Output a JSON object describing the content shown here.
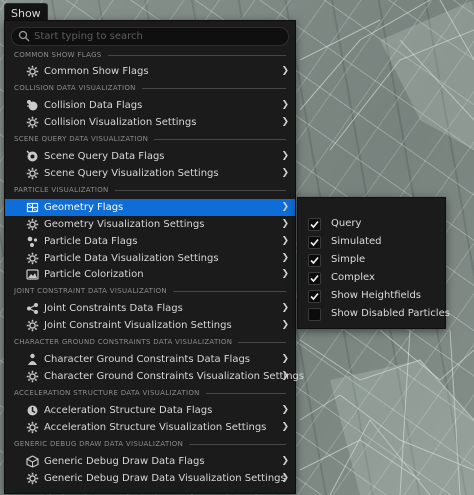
{
  "show_button": {
    "label": "Show"
  },
  "search": {
    "placeholder": "Start typing to search",
    "value": ""
  },
  "sections": [
    {
      "header": "COMMON SHOW FLAGS",
      "items": [
        {
          "label": "Common Show Flags",
          "icon": "gear-icon"
        }
      ]
    },
    {
      "header": "COLLISION DATA VISUALIZATION",
      "items": [
        {
          "label": "Collision Data Flags",
          "icon": "collision-icon"
        },
        {
          "label": "Collision Visualization Settings",
          "icon": "gear-icon"
        }
      ]
    },
    {
      "header": "SCENE QUERY DATA VISUALIZATION",
      "items": [
        {
          "label": "Scene Query Data Flags",
          "icon": "scene-query-icon"
        },
        {
          "label": "Scene Query Visualization Settings",
          "icon": "gear-icon"
        }
      ]
    },
    {
      "header": "PARTICLE VISUALIZATION",
      "items": [
        {
          "label": "Geometry Flags",
          "icon": "geometry-icon",
          "active": true
        },
        {
          "label": "Geometry Visualization Settings",
          "icon": "gear-icon"
        },
        {
          "label": "Particle Data Flags",
          "icon": "particle-icon"
        },
        {
          "label": "Particle Data Visualization Settings",
          "icon": "gear-icon"
        },
        {
          "label": "Particle Colorization",
          "icon": "colorization-icon"
        }
      ]
    },
    {
      "header": "JOINT CONSTRAINT DATA VISUALIZATION",
      "items": [
        {
          "label": "Joint Constraints Data Flags",
          "icon": "joint-icon"
        },
        {
          "label": "Joint Constraint Visualization Settings",
          "icon": "gear-icon"
        }
      ]
    },
    {
      "header": "CHARACTER GROUND CONSTRAINTS DATA VISUALIZATION",
      "items": [
        {
          "label": "Character Ground Constraints Data Flags",
          "icon": "character-icon"
        },
        {
          "label": "Character Ground Constraints Visualization Settings",
          "icon": "gear-icon"
        }
      ]
    },
    {
      "header": "ACCELERATION STRUCTURE DATA VISUALIZATION",
      "items": [
        {
          "label": "Acceleration Structure Data Flags",
          "icon": "acceleration-icon"
        },
        {
          "label": "Acceleration Structure Visualization Settings",
          "icon": "gear-icon"
        }
      ]
    },
    {
      "header": "GENERIC DEBUG DRAW DATA VISUALIZATION",
      "items": [
        {
          "label": "Generic Debug Draw Data Flags",
          "icon": "debug-draw-icon"
        },
        {
          "label": "Generic Debug Draw Data Visualization Settings",
          "icon": "gear-icon"
        }
      ]
    }
  ],
  "geometry_flags_submenu": [
    {
      "label": "Query",
      "checked": true
    },
    {
      "label": "Simulated",
      "checked": true
    },
    {
      "label": "Simple",
      "checked": true
    },
    {
      "label": "Complex",
      "checked": true
    },
    {
      "label": "Show Heightfields",
      "checked": true
    },
    {
      "label": "Show Disabled Particles",
      "checked": false
    }
  ],
  "colors": {
    "accent": "#0e6dd7",
    "menu_bg": "#1b1b1b",
    "viewport": "#7e8984"
  },
  "submenu_arrow_glyph": "❯"
}
